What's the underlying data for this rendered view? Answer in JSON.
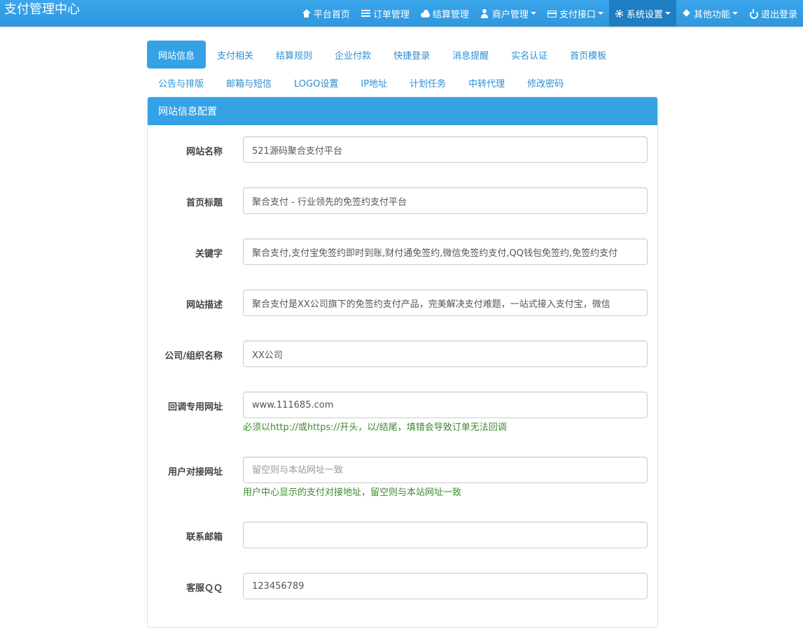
{
  "navbar": {
    "brand": "支付管理中心",
    "items": [
      {
        "label": "平台首页",
        "icon": "home-icon"
      },
      {
        "label": "订单管理",
        "icon": "list-icon"
      },
      {
        "label": "结算管理",
        "icon": "cloud-icon"
      },
      {
        "label": "商户管理",
        "icon": "user-icon"
      },
      {
        "label": "支付接口",
        "icon": "card-icon"
      },
      {
        "label": "系统设置",
        "icon": "gear-icon"
      },
      {
        "label": "其他功能",
        "icon": "cube-icon"
      },
      {
        "label": "退出登录",
        "icon": "power-icon"
      }
    ]
  },
  "tabs": {
    "row1": [
      "网站信息",
      "支付相关",
      "结算规则",
      "企业付款",
      "快捷登录",
      "消息提醒",
      "实名认证",
      "首页模板"
    ],
    "row2": [
      "公告与排版",
      "邮箱与短信",
      "LOGO设置",
      "IP地址",
      "计划任务",
      "中转代理",
      "修改密码"
    ]
  },
  "panel": {
    "title": "网站信息配置",
    "fields": [
      {
        "label": "网站名称",
        "value": "521源码聚合支付平台",
        "placeholder": ""
      },
      {
        "label": "首页标题",
        "value": "聚合支付 - 行业领先的免签约支付平台",
        "placeholder": ""
      },
      {
        "label": "关键字",
        "value": "聚合支付,支付宝免签约即时到账,财付通免签约,微信免签约支付,QQ钱包免签约,免签约支付",
        "placeholder": ""
      },
      {
        "label": "网站描述",
        "value": "聚合支付是XX公司旗下的免签约支付产品，完美解决支付难题，一站式接入支付宝，微信",
        "placeholder": ""
      },
      {
        "label": "公司/组织名称",
        "value": "XX公司",
        "placeholder": ""
      },
      {
        "label": "回调专用网址",
        "value": "www.111685.com",
        "placeholder": "",
        "help": "必须以http://或https://开头，以/结尾，填错会导致订单无法回调"
      },
      {
        "label": "用户对接网址",
        "value": "",
        "placeholder": "留空则与本站网址一致",
        "help": "用户中心显示的支付对接地址，留空则与本站网址一致"
      },
      {
        "label": "联系邮箱",
        "value": "",
        "placeholder": ""
      },
      {
        "label": "客服ＱＱ",
        "value": "123456789",
        "placeholder": ""
      }
    ]
  },
  "colors": {
    "navbar": "#2f97de",
    "nav_active": "#1f7dc2",
    "tab_active": "#35a2e6",
    "tab_text": "#2b8ed4",
    "help_text": "#3c8a2e"
  }
}
